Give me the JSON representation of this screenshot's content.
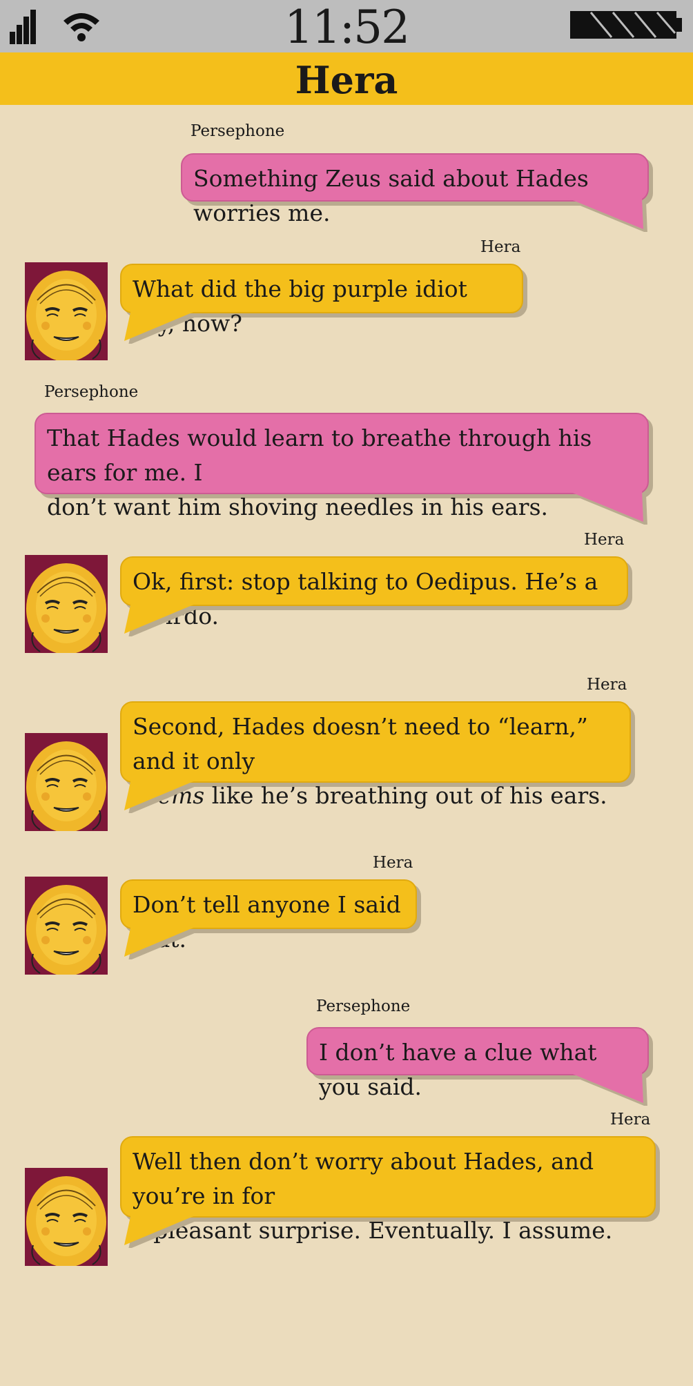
{
  "status": {
    "time": "11:52"
  },
  "header": {
    "title": "Hera"
  },
  "colors": {
    "persephone_bubble": "#e46fa8",
    "hera_bubble": "#f4bf1b",
    "header": "#f4bf1b",
    "background": "#ebdcbd"
  },
  "messages": [
    {
      "sender": "Persephone",
      "text": "Something Zeus said about Hades worries me."
    },
    {
      "sender": "Hera",
      "text": "What did the big purple idiot say, now?"
    },
    {
      "sender": "Persephone",
      "line1": "That Hades would learn to breathe through his ears for me. I",
      "line2": "don’t want him shoving needles in his ears."
    },
    {
      "sender": "Hera",
      "text": "Ok, first: stop talking to Oedipus. He’s a weirdo."
    },
    {
      "sender": "Hera",
      "line1": "Second, Hades doesn’t need to “learn,” and it only",
      "line2_em": "seems",
      "line2_rest": " like he’s breathing out of his ears."
    },
    {
      "sender": "Hera",
      "text": "Don’t tell anyone I said that."
    },
    {
      "sender": "Persephone",
      "text": "I don’t have a clue what you said."
    },
    {
      "sender": "Hera",
      "line1": "Well then don’t worry about Hades, and you’re in for",
      "line2": "a pleasant surprise. Eventually. I assume."
    }
  ]
}
